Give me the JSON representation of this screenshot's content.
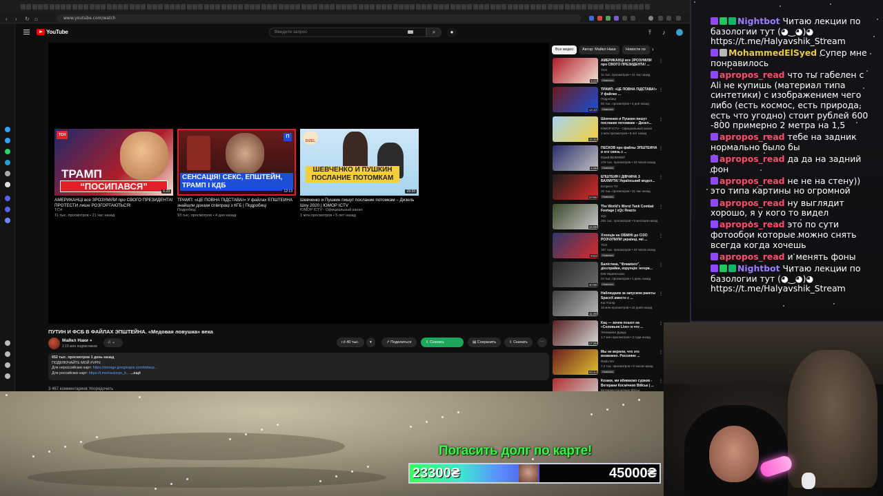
{
  "browser": {
    "url": "www.youtube.com/watch"
  },
  "youtube": {
    "brand": "YouTube",
    "search_placeholder": "Введите запрос",
    "video_title": "ПУТИН И ФСБ В ФАЙЛАХ ЭПШТЕЙНА. «Медовая ловушка» века",
    "channel_name": "Майкл Наки",
    "subscribers": "2,15 млн подписчиков",
    "likes": "40 тыс.",
    "share_label": "Поделиться",
    "download_label": "Скачать",
    "save_label": "Сохранить",
    "download2_label": "Скачать",
    "description": {
      "line1": "652 тыс. просмотров  1 день назад",
      "line2": "ПОДКЛЮЧАЙТЕ МОЙ #VPN:",
      "line3_prefix": "Для нероссийских карт:",
      "line3_link": "https://storage.googleapis.com/ktdacp...",
      "line4_prefix": "Для российских карт:",
      "line4_link": "https://t.me/nackivpn_b...",
      "more": "...ещё"
    },
    "comments_stub": "3 467 комментариев    Упорядочить",
    "endcards": [
      {
        "thumb_top": "ТРАМП",
        "thumb_bottom": "“ПОСИПАВСЯ”",
        "duration": "6:23",
        "title": "АМЕРИКАНЦІ все ЗРОЗУМІЛИ про СВОГО ПРЕЗИДЕНТА! ПРОТЕСТИ лише РОЗГОРТАЮТЬСЯ!",
        "channel": "ТСН",
        "meta": "11 тыс. просмотров • 21 час назад"
      },
      {
        "thumb_text": "СЕНСАЦІЯ! СЕКС, ЕПШТЕЙН, ТРАМП І КДБ",
        "duration": "12:13",
        "title": "ТРАМП: «ЦЕ ПОВНА ПІДСТАВА!» У файлах ЕПШТЕЙНА знайшли докази співпраці з КГБ | Подробиці",
        "channel": "Подробиці",
        "meta": "93 тыс. просмотров • 4 дня назад"
      },
      {
        "thumb_logo": "DIZEL",
        "thumb_text": "ШЕВЧЕНКО И ПУШКИН ПОСЛАНИЕ ПОТОМКАМ",
        "duration": "15:33",
        "title": "Шевченко и Пушкин пишут послание потомкам – Дизель Шоу 2020 | ЮМОР ICTV",
        "channel": "ЮМОР ICTV - Официальный канал",
        "meta": "1 млн просмотров • 5 лет назад"
      }
    ],
    "chips": [
      "Все видео",
      "Автор: Майкл Наки",
      "Новости по"
    ],
    "sidebar": [
      {
        "title": "АМЕРИКАНЦІ все ЗРОЗУМІЛИ про СВОГО ПРЕЗИДЕНТА! ...",
        "channel": "ТСН",
        "meta": "11 тыс. просмотров • 21 час назад",
        "badge": "Новинка",
        "duration": "6:23"
      },
      {
        "title": "ТРАМП: «ЦЕ ПОВНА ПІДСТАВА!» У файлах ...",
        "channel": "Подробиці",
        "meta": "93 тыс. просмотров • 4 дня назад",
        "badge": "Новинка",
        "duration": "12:13"
      },
      {
        "title": "Шевченко и Пушкин пишут послание потомкам – Дизел...",
        "channel": "ЮМОР ICTV - Официальный канал",
        "meta": "1 млн просмотров • 5 лет назад",
        "badge": "",
        "duration": "15:33"
      },
      {
        "title": "ПЕСКОВ про файлы ЭПШТЕЙНА и его связь с ...",
        "channel": "Юрий ВЕЛИКИЙ",
        "meta": "179 тыс. просмотров • 10 часов назад",
        "badge": "Новинка",
        "duration": "5:09"
      },
      {
        "title": "ЕПШТЕЙН І ДІВЧИНА З БАХМУТА! Український модел...",
        "channel": "Еспресо TV",
        "meta": "25 тыс. просмотров • 21 час назад",
        "badge": "Новинка",
        "duration": "10:56"
      },
      {
        "title": "The World's Worst Tank Combat Footage | xQc Reacts",
        "channel": "xQc",
        "meta": "281 тыс. просмотров • 5 месяцев назад",
        "badge": "",
        "duration": "16:59"
      },
      {
        "title": "Хлопців на ОБМІНІ до СІЗО РОЗЧУЛИЛИ українці, які ...",
        "channel": "ТСН",
        "meta": "157 тыс. просмотров • 10 часов назад",
        "badge": "Новинка",
        "duration": "8:53"
      },
      {
        "title": "Балістика, \"Фламінго\", дієспрайки, корупція: інтерв...",
        "channel": "DW Українською",
        "meta": "24 тыс. просмотров • 1 день назад",
        "badge": "Новинка",
        "duration": "40:59"
      },
      {
        "title": "Наблюдаем за запуском ракеты SpaceX вместе с ...",
        "channel": "Kai Trump",
        "meta": "10 млн просмотров • 10 дней назад",
        "badge": "",
        "duration": "11:48"
      },
      {
        "title": "Кац — зачем пошел на «Соловьев Live» и что ...",
        "channel": "Телеканал Дождь",
        "meta": "1,7 млн просмотров • 2 года назад",
        "badge": "",
        "duration": "17:26"
      },
      {
        "title": "Мы не верили, что это возможно. Россияне ...",
        "channel": "Radio NV",
        "meta": "7,4 тыс. просмотров • 9 часов назад",
        "badge": "Новинка",
        "duration": "23:44"
      },
      {
        "title": "Козаки, ми вбиваємо суржик - Ветерани Космічних Військ | ...",
        "channel": "Ветерани Космічних Військ",
        "meta": "",
        "badge": "",
        "duration": ""
      }
    ]
  },
  "chat": {
    "messages": [
      {
        "user": "Nightbot",
        "user_color": "#9b7dff",
        "badges": [
          "#9147ff",
          "#22c55e",
          "#15b36b"
        ],
        "text": "Читаю лекции по базологии тут (◕‿◕)◕ https://t.me/Halyavshik_Stream"
      },
      {
        "user": "MohammedElSyed",
        "user_color": "#e6c84a",
        "badges": [
          "#9147ff",
          "#b7b7b7"
        ],
        "text": "Супер мне понравилось"
      },
      {
        "user": "apropos_read",
        "user_color": "#ff4d6b",
        "badges": [
          "#9147ff"
        ],
        "text": "что ты габелен с Ali не купишь (материал типа синтетики) с изображением чего либо (есть космос, есть природа, есть что угодно) стоит рублей 600 -800 примерно 2 метра на 1,5"
      },
      {
        "user": "apropos_read",
        "user_color": "#ff4d6b",
        "badges": [
          "#9147ff"
        ],
        "text": "тебе на задник нормально было бы"
      },
      {
        "user": "apropos_read",
        "user_color": "#ff4d6b",
        "badges": [
          "#9147ff"
        ],
        "text": "да да на задний фон"
      },
      {
        "user": "apropos_read",
        "user_color": "#ff4d6b",
        "badges": [
          "#9147ff"
        ],
        "text": "не не на стену)) это типа картины но огромной"
      },
      {
        "user": "apropos_read",
        "user_color": "#ff4d6b",
        "badges": [
          "#9147ff"
        ],
        "text": "ну выглядит хорошо, я у кого то видел"
      },
      {
        "user": "apropos_read",
        "user_color": "#ff4d6b",
        "badges": [
          "#9147ff"
        ],
        "text": "это по сути фотообои которые можно снять всегда когда хочешь"
      },
      {
        "user": "apropos_read",
        "user_color": "#ff4d6b",
        "badges": [
          "#9147ff"
        ],
        "text": "и менять фоны"
      },
      {
        "user": "Nightbot",
        "user_color": "#9b7dff",
        "badges": [
          "#9147ff",
          "#22c55e",
          "#15b36b"
        ],
        "text": "Читаю лекции по базологии тут (◕‿◕)◕ https://t.me/Halyavshik_Stream"
      }
    ]
  },
  "overlay": {
    "goal_title": "Погасить долг по карте!",
    "current": "23300₴",
    "target": "45000₴",
    "progress_fraction": 0.518
  }
}
